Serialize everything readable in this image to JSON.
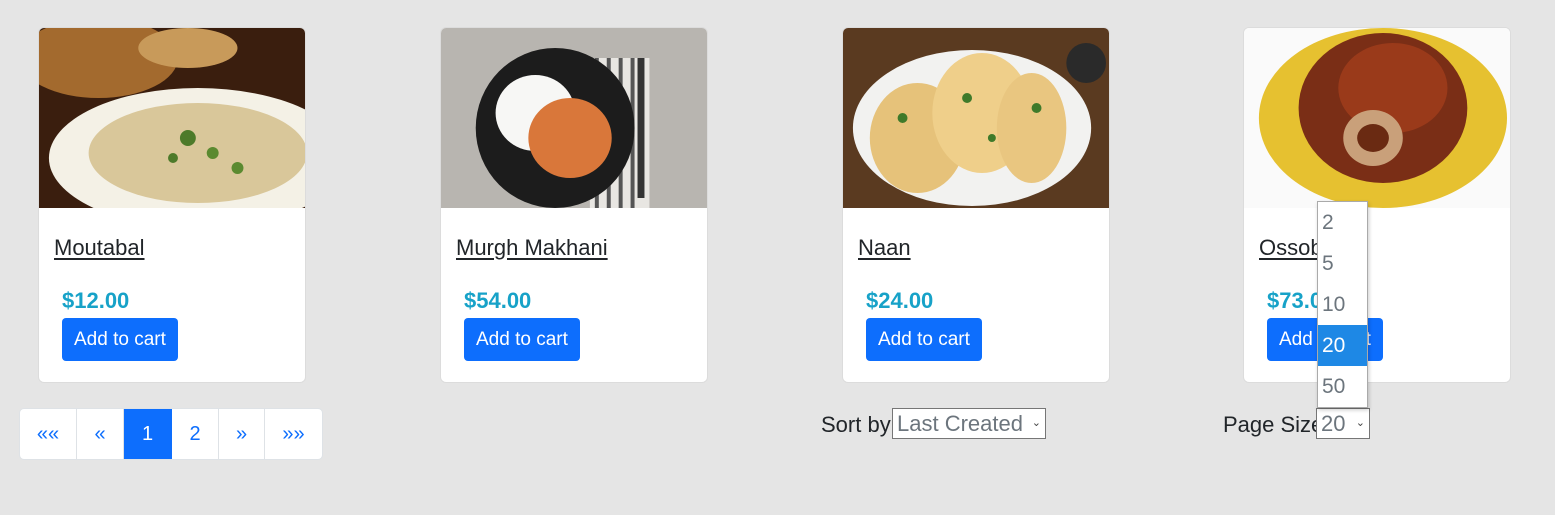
{
  "products": [
    {
      "name": "Moutabal",
      "price": "$12.00",
      "button": "Add to cart",
      "image": "moutabal-dip-photo"
    },
    {
      "name": "Murgh Makhani",
      "price": "$54.00",
      "button": "Add to cart",
      "image": "murgh-makhani-rice-photo"
    },
    {
      "name": "Naan",
      "price": "$24.00",
      "button": "Add to cart",
      "image": "naan-bread-photo"
    },
    {
      "name": "Ossobuco",
      "price": "$73.00",
      "button": "Add to cart",
      "image": "ossobuco-risotto-photo"
    }
  ],
  "pagination": {
    "first": "««",
    "prev": "«",
    "pages": [
      "1",
      "2"
    ],
    "current": "1",
    "next": "»",
    "last": "»»"
  },
  "sort": {
    "label": "Sort by",
    "selected": "Last Created"
  },
  "page_size": {
    "label": "Page Size",
    "selected": "20",
    "options": [
      "2",
      "5",
      "10",
      "20",
      "50"
    ]
  },
  "colors": {
    "primary": "#0d6efd",
    "price": "#17a2c8",
    "background": "#e5e5e5",
    "highlight": "#1e88e5"
  }
}
